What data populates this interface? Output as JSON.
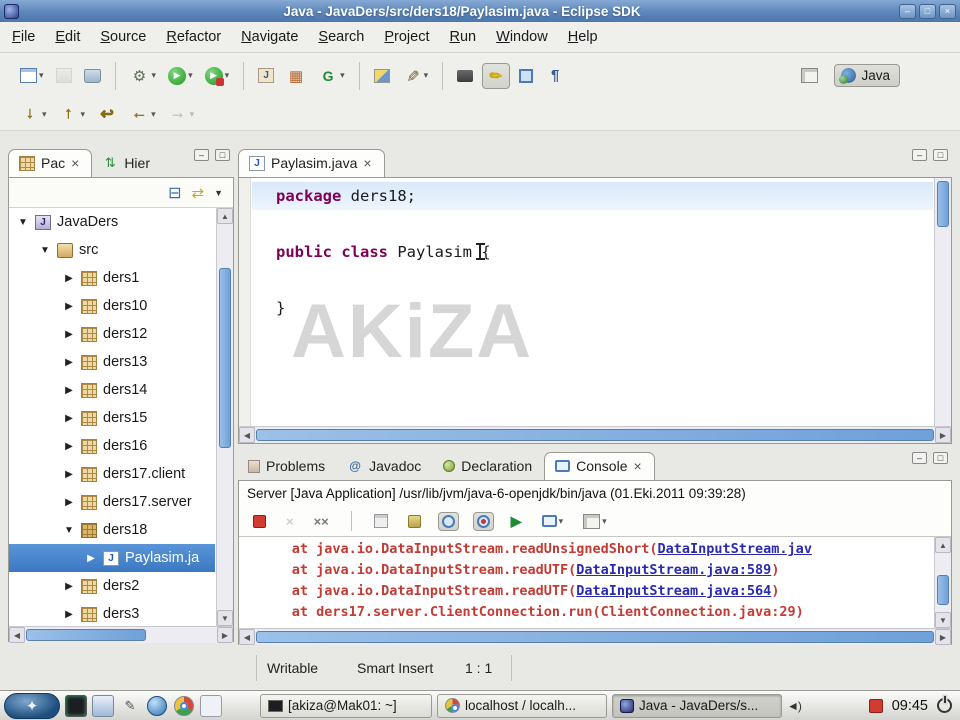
{
  "window": {
    "title": "Java - JavaDers/src/ders18/Paylasim.java - Eclipse SDK"
  },
  "menu": {
    "items": [
      "File",
      "Edit",
      "Source",
      "Refactor",
      "Navigate",
      "Search",
      "Project",
      "Run",
      "Window",
      "Help"
    ]
  },
  "toolbar": {
    "perspective_label": "Java"
  },
  "explorer": {
    "tabs": [
      {
        "label": "Pac"
      },
      {
        "label": "Hier"
      }
    ],
    "items": [
      {
        "label": "JavaDers"
      },
      {
        "label": "src"
      },
      {
        "label": "ders1"
      },
      {
        "label": "ders10"
      },
      {
        "label": "ders12"
      },
      {
        "label": "ders13"
      },
      {
        "label": "ders14"
      },
      {
        "label": "ders15"
      },
      {
        "label": "ders16"
      },
      {
        "label": "ders17.client"
      },
      {
        "label": "ders17.server"
      },
      {
        "label": "ders18"
      },
      {
        "label": "Paylasim.ja"
      },
      {
        "label": "ders2"
      },
      {
        "label": "ders3"
      }
    ]
  },
  "editor": {
    "tab_label": "Paylasim.java",
    "watermark": "AKiZA",
    "code": {
      "line1_keyword": "package",
      "line1_rest": " ders18;",
      "line3_keyword": "public class",
      "line3_rest": " Paylasim {",
      "line5_text": "}"
    }
  },
  "console": {
    "tabs": [
      {
        "label": "Problems"
      },
      {
        "label": "Javadoc"
      },
      {
        "label": "Declaration"
      },
      {
        "label": "Console"
      }
    ],
    "header": "Server [Java Application] /usr/lib/jvm/java-6-openjdk/bin/java (01.Eki.2011 09:39:28)",
    "lines": [
      {
        "prefix": "      at java.io.DataInputStream.readUnsignedShort(",
        "link": "DataInputStream.jav",
        "suffix": ""
      },
      {
        "prefix": "      at java.io.DataInputStream.readUTF(",
        "link": "DataInputStream.java:589",
        "suffix": ")"
      },
      {
        "prefix": "      at java.io.DataInputStream.readUTF(",
        "link": "DataInputStream.java:564",
        "suffix": ")"
      },
      {
        "prefix": "      at ders17.server.ClientConnection.run(ClientConnection.java:29)",
        "link": "",
        "suffix": ""
      }
    ]
  },
  "status": {
    "writable": "Writable",
    "insert_mode": "Smart Insert",
    "caret_position": "1 : 1"
  },
  "taskbar": {
    "tasks": [
      {
        "label": "[akiza@Mak01: ~]"
      },
      {
        "label": "localhost / localh..."
      },
      {
        "label": "Java - JavaDers/s..."
      }
    ],
    "clock": "09:45"
  },
  "colors": {
    "titlebar_blue": "#5d87bb",
    "selection_blue": "#3a78c2",
    "keyword_magenta": "#7f0055",
    "console_red": "#c33b33",
    "link_blue": "#2a2ab0",
    "watermark_gray": "#d6d6d6"
  },
  "icons": {
    "minimize": "–",
    "maximize": "□",
    "close": "×",
    "dropdown": "▾",
    "expanded": "▼",
    "collapsed": "▶",
    "play": "▶",
    "gear": "⚙",
    "grid": "▦",
    "pencil": "✎",
    "at": "@",
    "pilcrow": "¶",
    "arrow_down": "↓",
    "arrow_up": "↑",
    "arrow_left": "←",
    "arrow_right": "→",
    "arrow_back_edit": "↩",
    "collapse_all": "⊟",
    "link_editor": "⇄",
    "view_menu": "▼",
    "scroll_up": "▲",
    "scroll_down": "▼",
    "scroll_left": "◀",
    "scroll_right": "▶",
    "cross": "×",
    "volume": "◄)"
  }
}
